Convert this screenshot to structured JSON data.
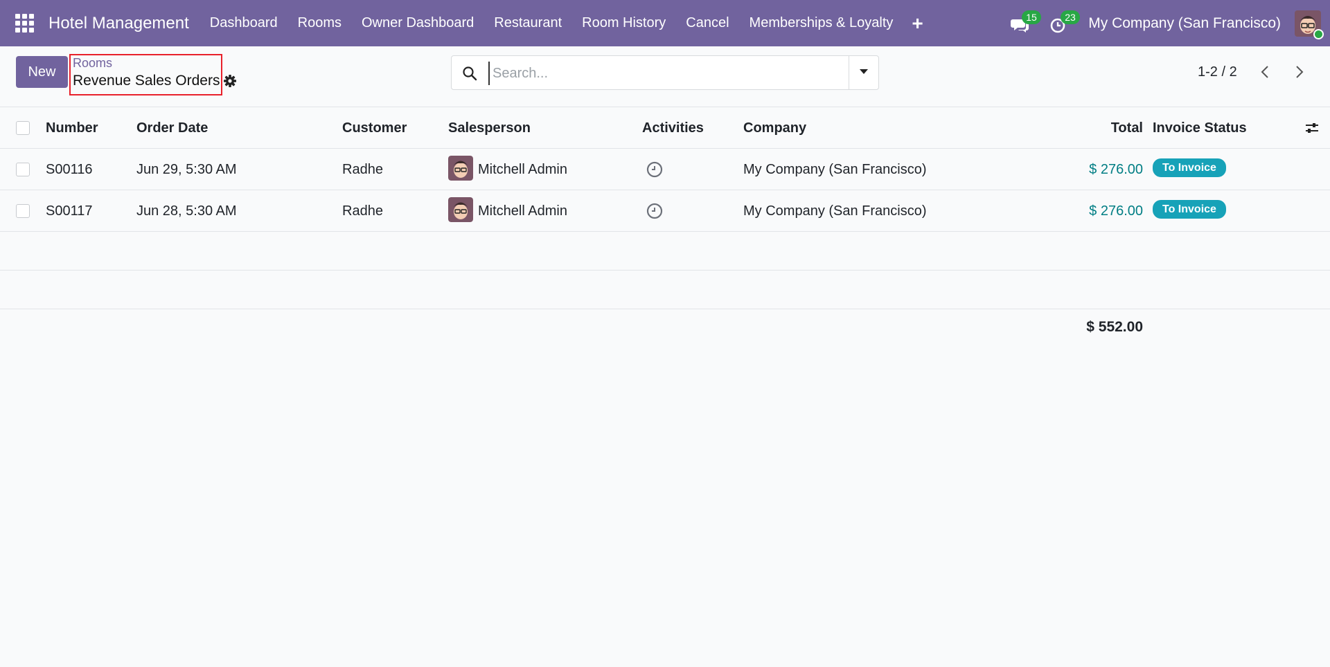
{
  "navbar": {
    "brand": "Hotel Management",
    "menu": [
      "Dashboard",
      "Rooms",
      "Owner Dashboard",
      "Restaurant",
      "Room History",
      "Cancel",
      "Memberships & Loyalty"
    ],
    "plus": "+",
    "messages_count": "15",
    "activities_count": "23",
    "company": "My Company (San Francisco)",
    "accent": "#71639e"
  },
  "control": {
    "new_label": "New",
    "breadcrumb_parent": "Rooms",
    "breadcrumb_current": "Revenue Sales Orders",
    "search_placeholder": "Search...",
    "pager": "1-2 / 2"
  },
  "table": {
    "headers": {
      "number": "Number",
      "date": "Order Date",
      "customer": "Customer",
      "salesperson": "Salesperson",
      "activities": "Activities",
      "company": "Company",
      "total": "Total",
      "invoice": "Invoice Status"
    },
    "rows": [
      {
        "number": "S00116",
        "date": "Jun 29, 5:30 AM",
        "customer": "Radhe",
        "salesperson": "Mitchell Admin",
        "company": "My Company (San Francisco)",
        "total": "$ 276.00",
        "invoice": "To Invoice"
      },
      {
        "number": "S00117",
        "date": "Jun 28, 5:30 AM",
        "customer": "Radhe",
        "salesperson": "Mitchell Admin",
        "company": "My Company (San Francisco)",
        "total": "$ 276.00",
        "invoice": "To Invoice"
      }
    ],
    "grand_total": "$ 552.00"
  }
}
